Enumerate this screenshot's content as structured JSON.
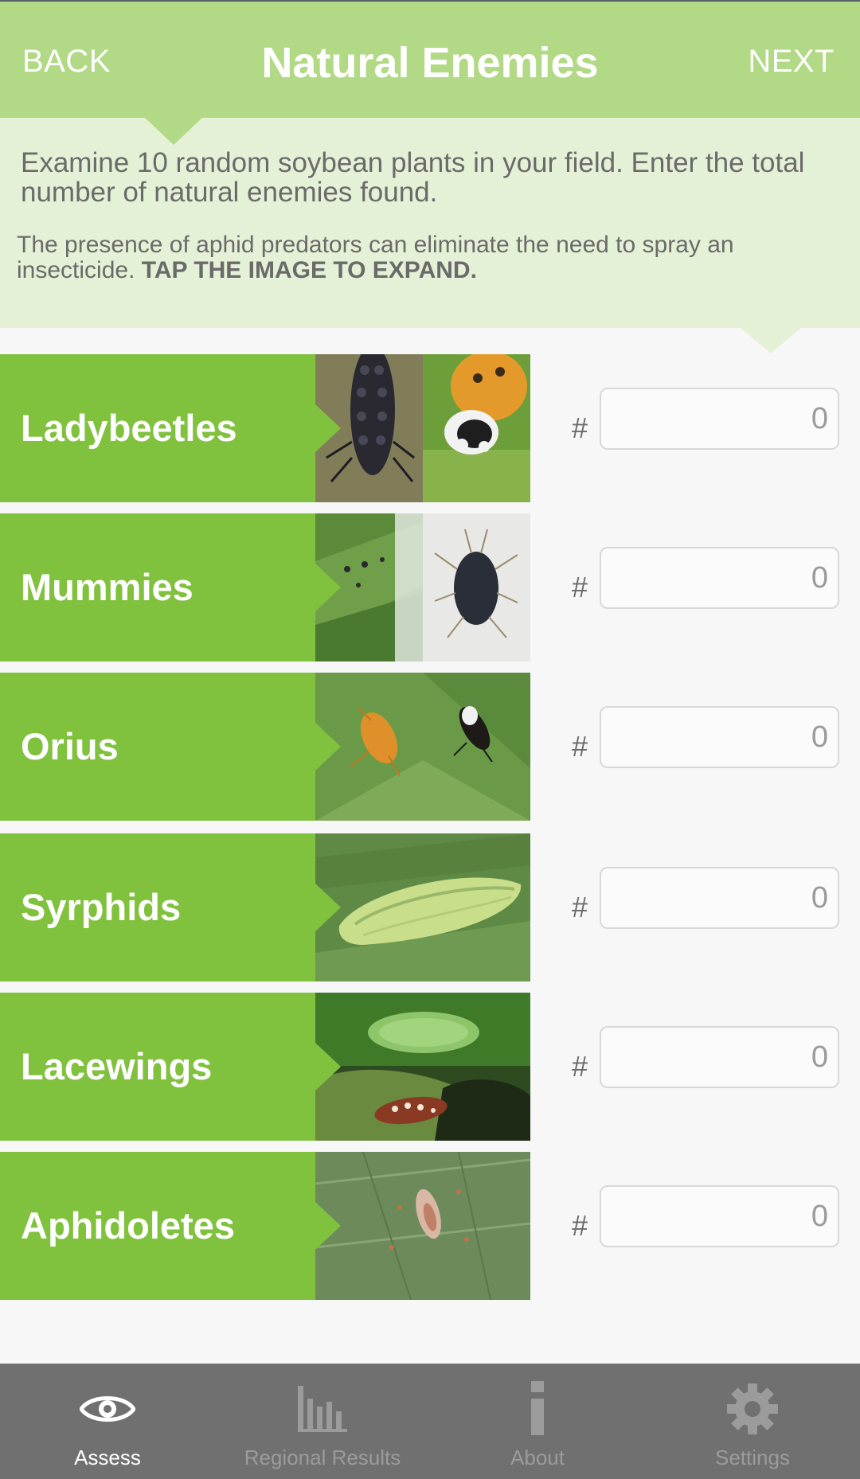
{
  "header": {
    "back_label": "BACK",
    "title": "Natural Enemies",
    "next_label": "NEXT"
  },
  "instructions": {
    "main": "Examine 10 random soybean plants in your field. Enter the total number of natural enemies found.",
    "sub_text": "The presence of aphid predators can eliminate the need to spray an insecticide. ",
    "sub_emphasis": "TAP THE IMAGE TO EXPAND."
  },
  "rows": [
    {
      "label": "Ladybeetles",
      "hash": "#",
      "value": "0",
      "image_icon": "ladybeetle-larva-and-adult-photo"
    },
    {
      "label": "Mummies",
      "hash": "#",
      "value": "0",
      "image_icon": "aphid-mummy-photo"
    },
    {
      "label": "Orius",
      "hash": "#",
      "value": "0",
      "image_icon": "orius-bug-photo"
    },
    {
      "label": "Syrphids",
      "hash": "#",
      "value": "0",
      "image_icon": "syrphid-larva-photo"
    },
    {
      "label": "Lacewings",
      "hash": "#",
      "value": "0",
      "image_icon": "lacewing-photo"
    },
    {
      "label": "Aphidoletes",
      "hash": "#",
      "value": "0",
      "image_icon": "aphidoletes-larva-photo"
    }
  ],
  "tabs": [
    {
      "label": "Assess",
      "icon": "eye-icon",
      "active": true
    },
    {
      "label": "Regional Results",
      "icon": "bar-chart-icon",
      "active": false
    },
    {
      "label": "About",
      "icon": "info-icon",
      "active": false
    },
    {
      "label": "Settings",
      "icon": "gear-icon",
      "active": false
    }
  ],
  "colors": {
    "header_bg": "#b2d985",
    "instructions_bg": "#e4f1d6",
    "row_label_bg": "#80c13e",
    "tabbar_bg": "#707070"
  }
}
